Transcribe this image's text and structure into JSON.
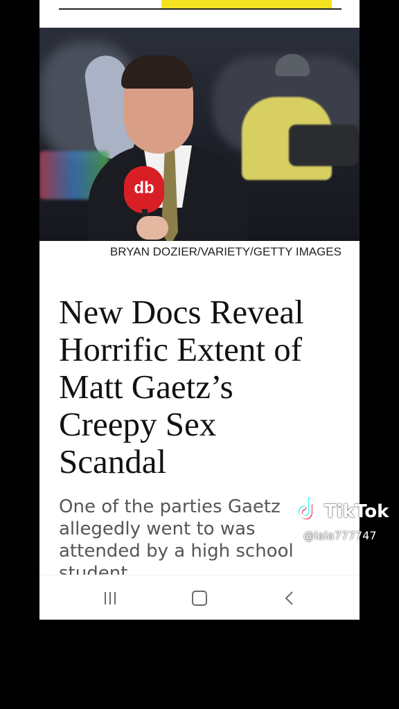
{
  "article": {
    "photo_credit": "BRYAN DOZIER/VARIETY/GETTY IMAGES",
    "mic_logo_text": "db",
    "headline_lines": [
      "New Docs Reveal",
      "Horrific Extent of",
      "Matt Gaetz’s",
      "Creepy Sex",
      "Scandal"
    ],
    "dek": "One of the parties Gaetz allegedly went to was attended by a high school student"
  },
  "progress": {
    "fraction": 0.6
  },
  "watermark": {
    "brand": "TikTok",
    "handle": "@lala777747"
  },
  "nav": {
    "icons": [
      "recents-icon",
      "home-icon",
      "back-icon"
    ]
  },
  "colors": {
    "progress": "#f3e221",
    "mic": "#d91f26"
  }
}
